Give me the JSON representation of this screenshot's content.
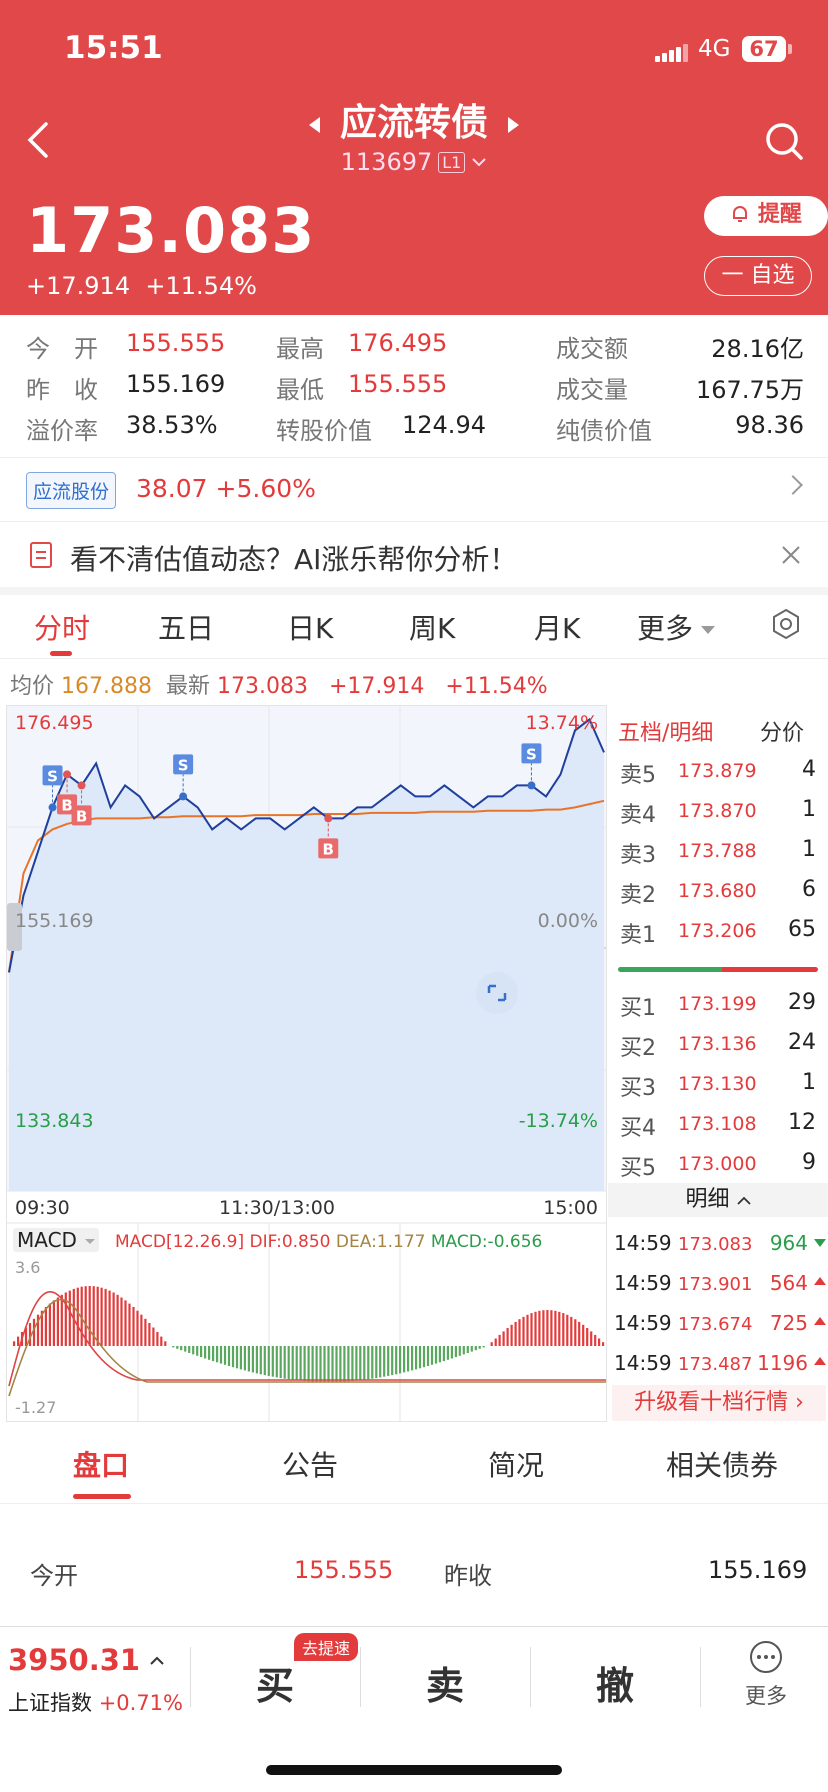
{
  "status": {
    "time": "15:51",
    "network": "4G",
    "battery": "67"
  },
  "header": {
    "title": "应流转债",
    "code": "113697",
    "level": "L1",
    "price": "173.083",
    "change": "+17.914",
    "change_pct": "+11.54%",
    "remind_label": "提醒",
    "fav_label": "一 自选"
  },
  "quote": {
    "open_label": "今　开",
    "open": "155.555",
    "high_label": "最高",
    "high": "176.495",
    "amount_label": "成交额",
    "amount": "28.16亿",
    "prev_label": "昨　收",
    "prev": "155.169",
    "low_label": "最低",
    "low": "155.555",
    "volume_label": "成交量",
    "volume": "167.75万",
    "premium_label": "溢价率",
    "premium": "38.53%",
    "conv_label": "转股价值",
    "conv": "124.94",
    "bond_label": "纯债价值",
    "bond": "98.36"
  },
  "stock": {
    "name": "应流股份",
    "price": "38.07",
    "pct": "+5.60%"
  },
  "ai_banner": "看不清估值动态？AI涨乐帮你分析！",
  "kline_tabs": [
    "分时",
    "五日",
    "日K",
    "周K",
    "月K",
    "更多"
  ],
  "avg_row": {
    "avg_label": "均价",
    "avg": "167.888",
    "last_label": "最新",
    "last": "173.083",
    "chg": "+17.914",
    "pct": "+11.54%"
  },
  "chart_labels": {
    "max": "176.495",
    "max_pct": "13.74%",
    "mid": "155.169",
    "mid_pct": "0.00%",
    "min": "133.843",
    "min_pct": "-13.74%",
    "t0": "09:30",
    "t1": "11:30/13:00",
    "t2": "15:00"
  },
  "macd": {
    "label": "MACD",
    "params": "MACD[12.26.9]",
    "dif": "DIF:0.850",
    "dea": "DEA:1.177",
    "macd": "MACD:-0.656",
    "top": "3.6",
    "bottom": "-1.27"
  },
  "chart_data": {
    "type": "line",
    "title": "",
    "x_labels": [
      "09:30",
      "11:30/13:00",
      "15:00"
    ],
    "ylim": [
      133.843,
      176.495
    ],
    "reference": 155.169,
    "series": [
      {
        "name": "",
        "values": [
          153,
          160,
          164,
          168,
          171,
          170,
          172,
          168,
          170,
          169,
          167,
          168,
          169,
          168,
          166,
          167,
          166,
          167,
          167,
          166,
          167,
          168,
          167,
          167,
          168,
          168,
          169,
          170,
          169,
          169,
          170,
          169,
          168,
          169,
          169,
          170,
          170,
          169,
          171,
          175,
          176,
          173
        ]
      },
      {
        "name": "",
        "values": [
          153,
          162,
          165,
          166,
          166.5,
          166.8,
          167,
          167,
          167,
          167,
          167.1,
          167.1,
          167.2,
          167.2,
          167.2,
          167.2,
          167.2,
          167.3,
          167.3,
          167.3,
          167.3,
          167.4,
          167.4,
          167.4,
          167.4,
          167.5,
          167.5,
          167.5,
          167.5,
          167.6,
          167.6,
          167.6,
          167.6,
          167.7,
          167.7,
          167.7,
          167.7,
          167.8,
          167.8,
          168,
          168.3,
          168.6
        ]
      }
    ]
  },
  "markers": [
    "S",
    "B",
    "B",
    "S",
    "B",
    "S"
  ],
  "orderbook": {
    "title": "五档/明细",
    "tab2": "分价",
    "asks": [
      {
        "n": "卖5",
        "p": "173.879",
        "v": "4"
      },
      {
        "n": "卖4",
        "p": "173.870",
        "v": "1"
      },
      {
        "n": "卖3",
        "p": "173.788",
        "v": "1"
      },
      {
        "n": "卖2",
        "p": "173.680",
        "v": "6"
      },
      {
        "n": "卖1",
        "p": "173.206",
        "v": "65"
      }
    ],
    "bids": [
      {
        "n": "买1",
        "p": "173.199",
        "v": "29"
      },
      {
        "n": "买2",
        "p": "173.136",
        "v": "24"
      },
      {
        "n": "买3",
        "p": "173.130",
        "v": "1"
      },
      {
        "n": "买4",
        "p": "173.108",
        "v": "12"
      },
      {
        "n": "买5",
        "p": "173.000",
        "v": "9"
      }
    ],
    "detail_label": "明细",
    "ticks": [
      {
        "t": "14:59",
        "p": "173.083",
        "v": "964"
      },
      {
        "t": "14:59",
        "p": "173.901",
        "v": "564"
      },
      {
        "t": "14:59",
        "p": "173.674",
        "v": "725"
      },
      {
        "t": "14:59",
        "p": "173.487",
        "v": "1196"
      }
    ],
    "upgrade": "升级看十档行情"
  },
  "bottom_tabs": [
    "盘口",
    "公告",
    "简况",
    "相关债券"
  ],
  "pankou": {
    "open_label": "今开",
    "open": "155.555",
    "prev_label": "昨收",
    "prev": "155.169"
  },
  "footer": {
    "index": "3950.31",
    "index_name": "上证指数",
    "index_pct": "+0.71%",
    "buy": "买",
    "buy_badge": "去提速",
    "sell": "卖",
    "cancel": "撤",
    "more": "更多"
  }
}
